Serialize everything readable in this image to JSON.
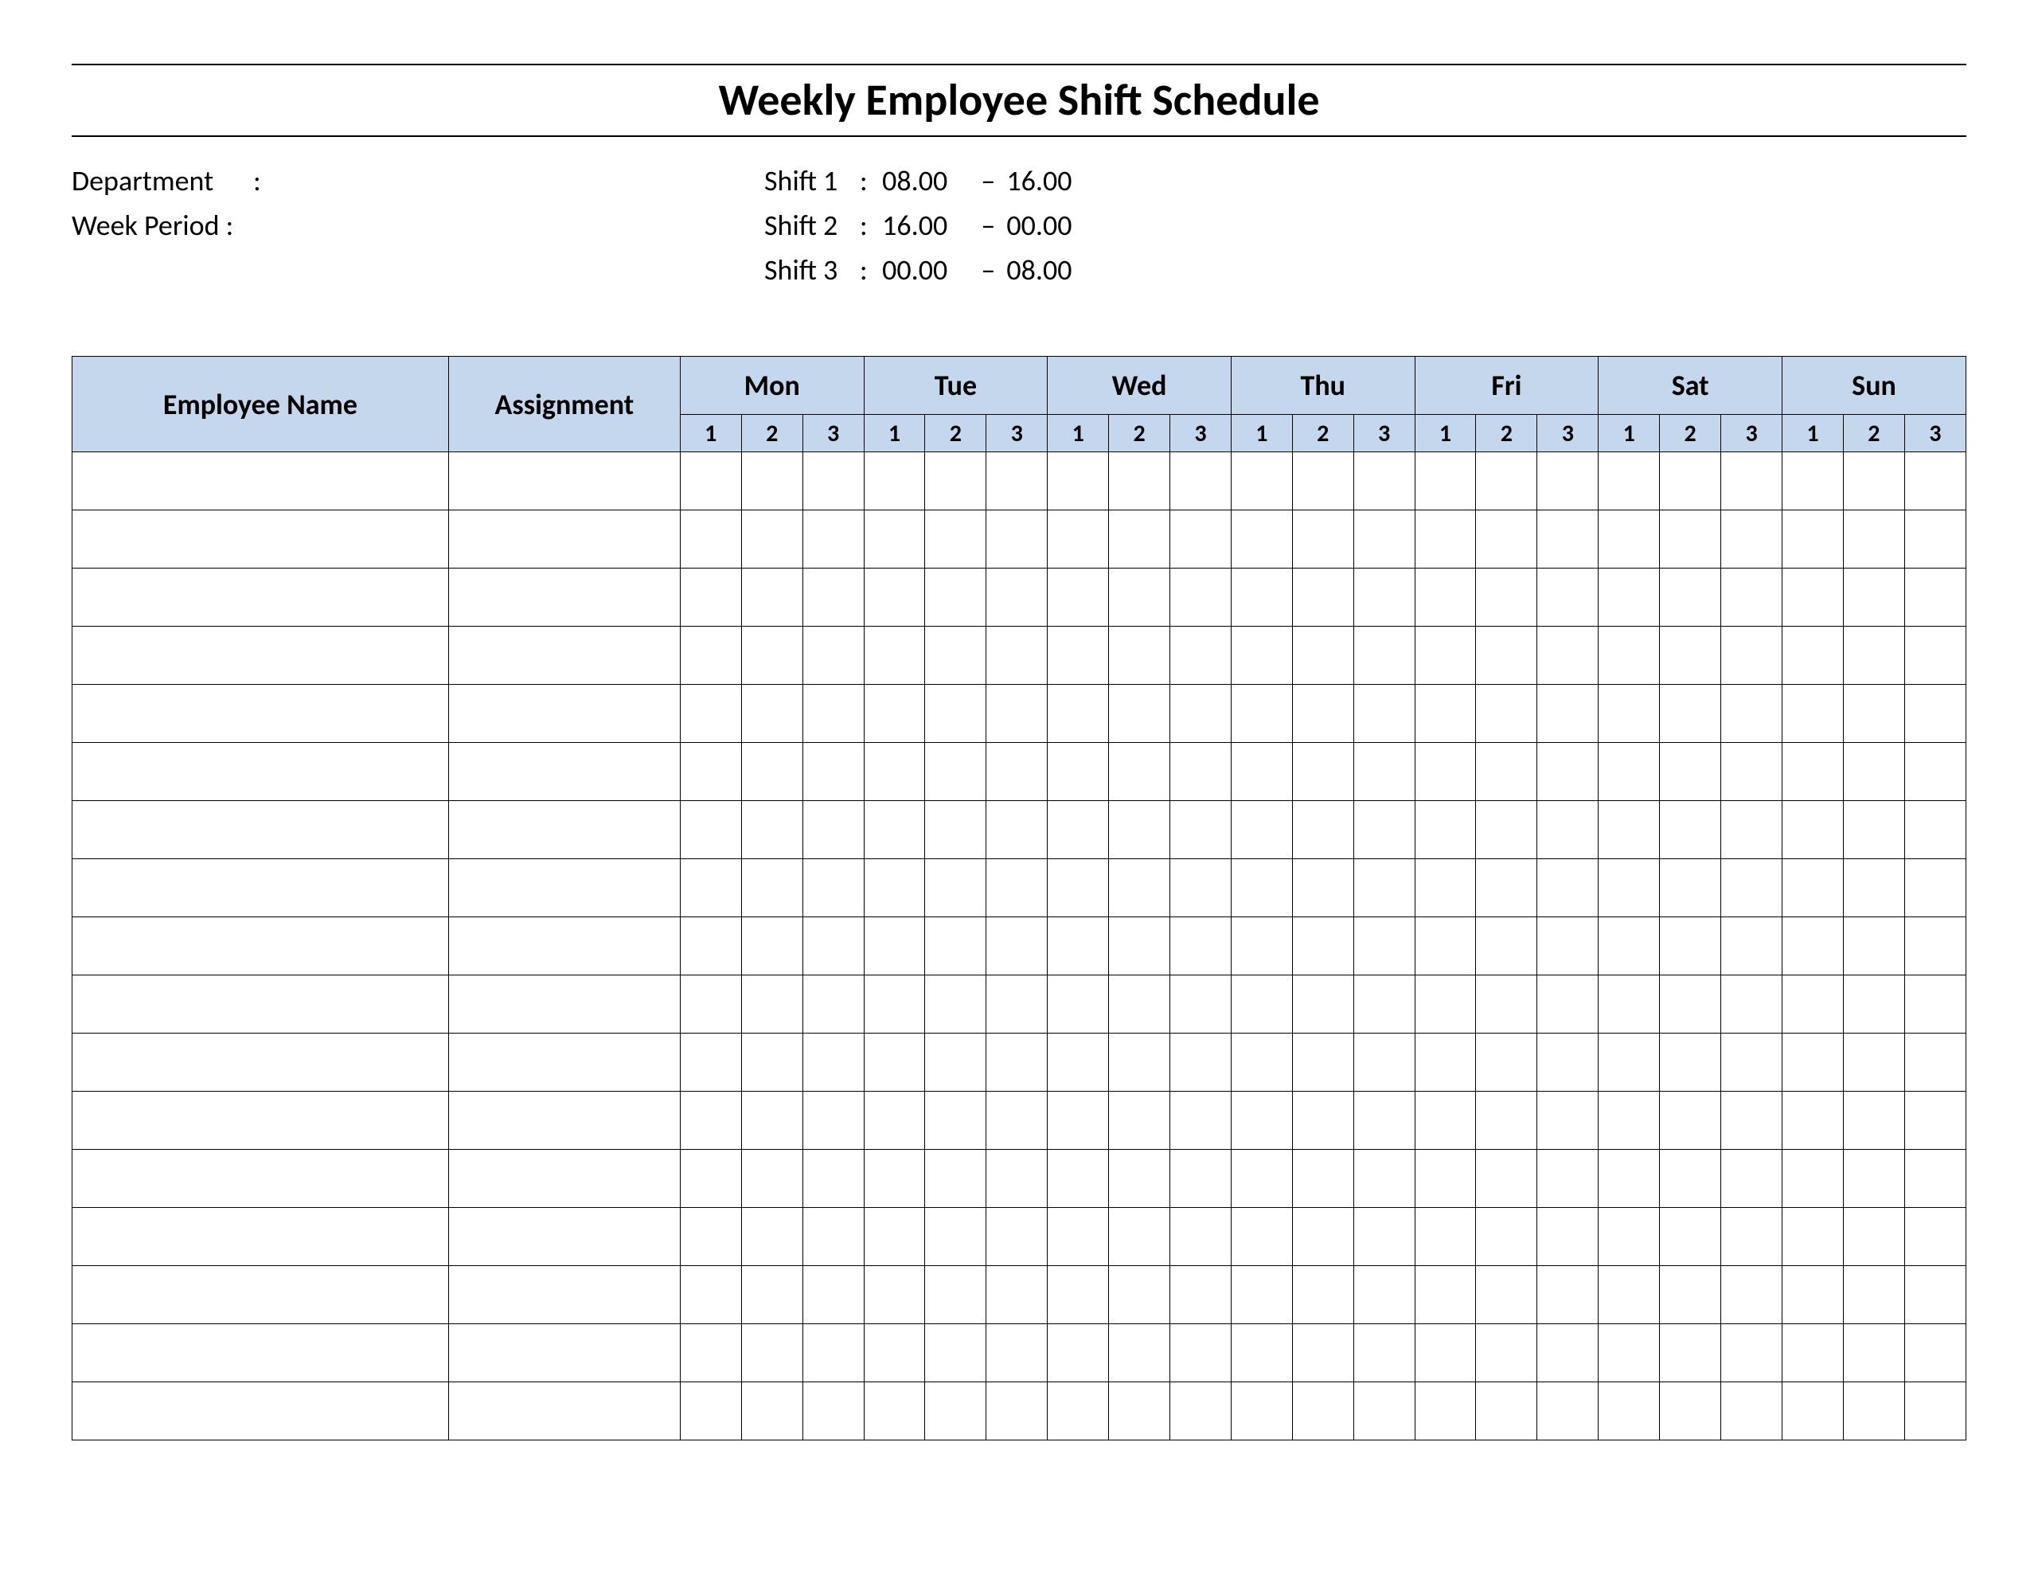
{
  "title": "Weekly Employee Shift Schedule",
  "meta": {
    "department_label": "Department",
    "department_sep": ":",
    "department_value": "",
    "week_period_label": "Week  Period :",
    "week_period_value": ""
  },
  "shifts": [
    {
      "label": "Shift 1",
      "start": "08.00",
      "end": "16.00"
    },
    {
      "label": "Shift 2",
      "start": "16.00",
      "end": "00.00"
    },
    {
      "label": "Shift 3",
      "start": "00.00",
      "end": "08.00"
    }
  ],
  "shift_dash": "–",
  "headers": {
    "employee": "Employee Name",
    "assignment": "Assignment",
    "days": [
      "Mon",
      "Tue",
      "Wed",
      "Thu",
      "Fri",
      "Sat",
      "Sun"
    ],
    "shift_cols": [
      "1",
      "2",
      "3"
    ]
  },
  "rows": [
    {},
    {},
    {},
    {},
    {},
    {},
    {},
    {},
    {},
    {},
    {},
    {},
    {},
    {},
    {},
    {},
    {}
  ]
}
